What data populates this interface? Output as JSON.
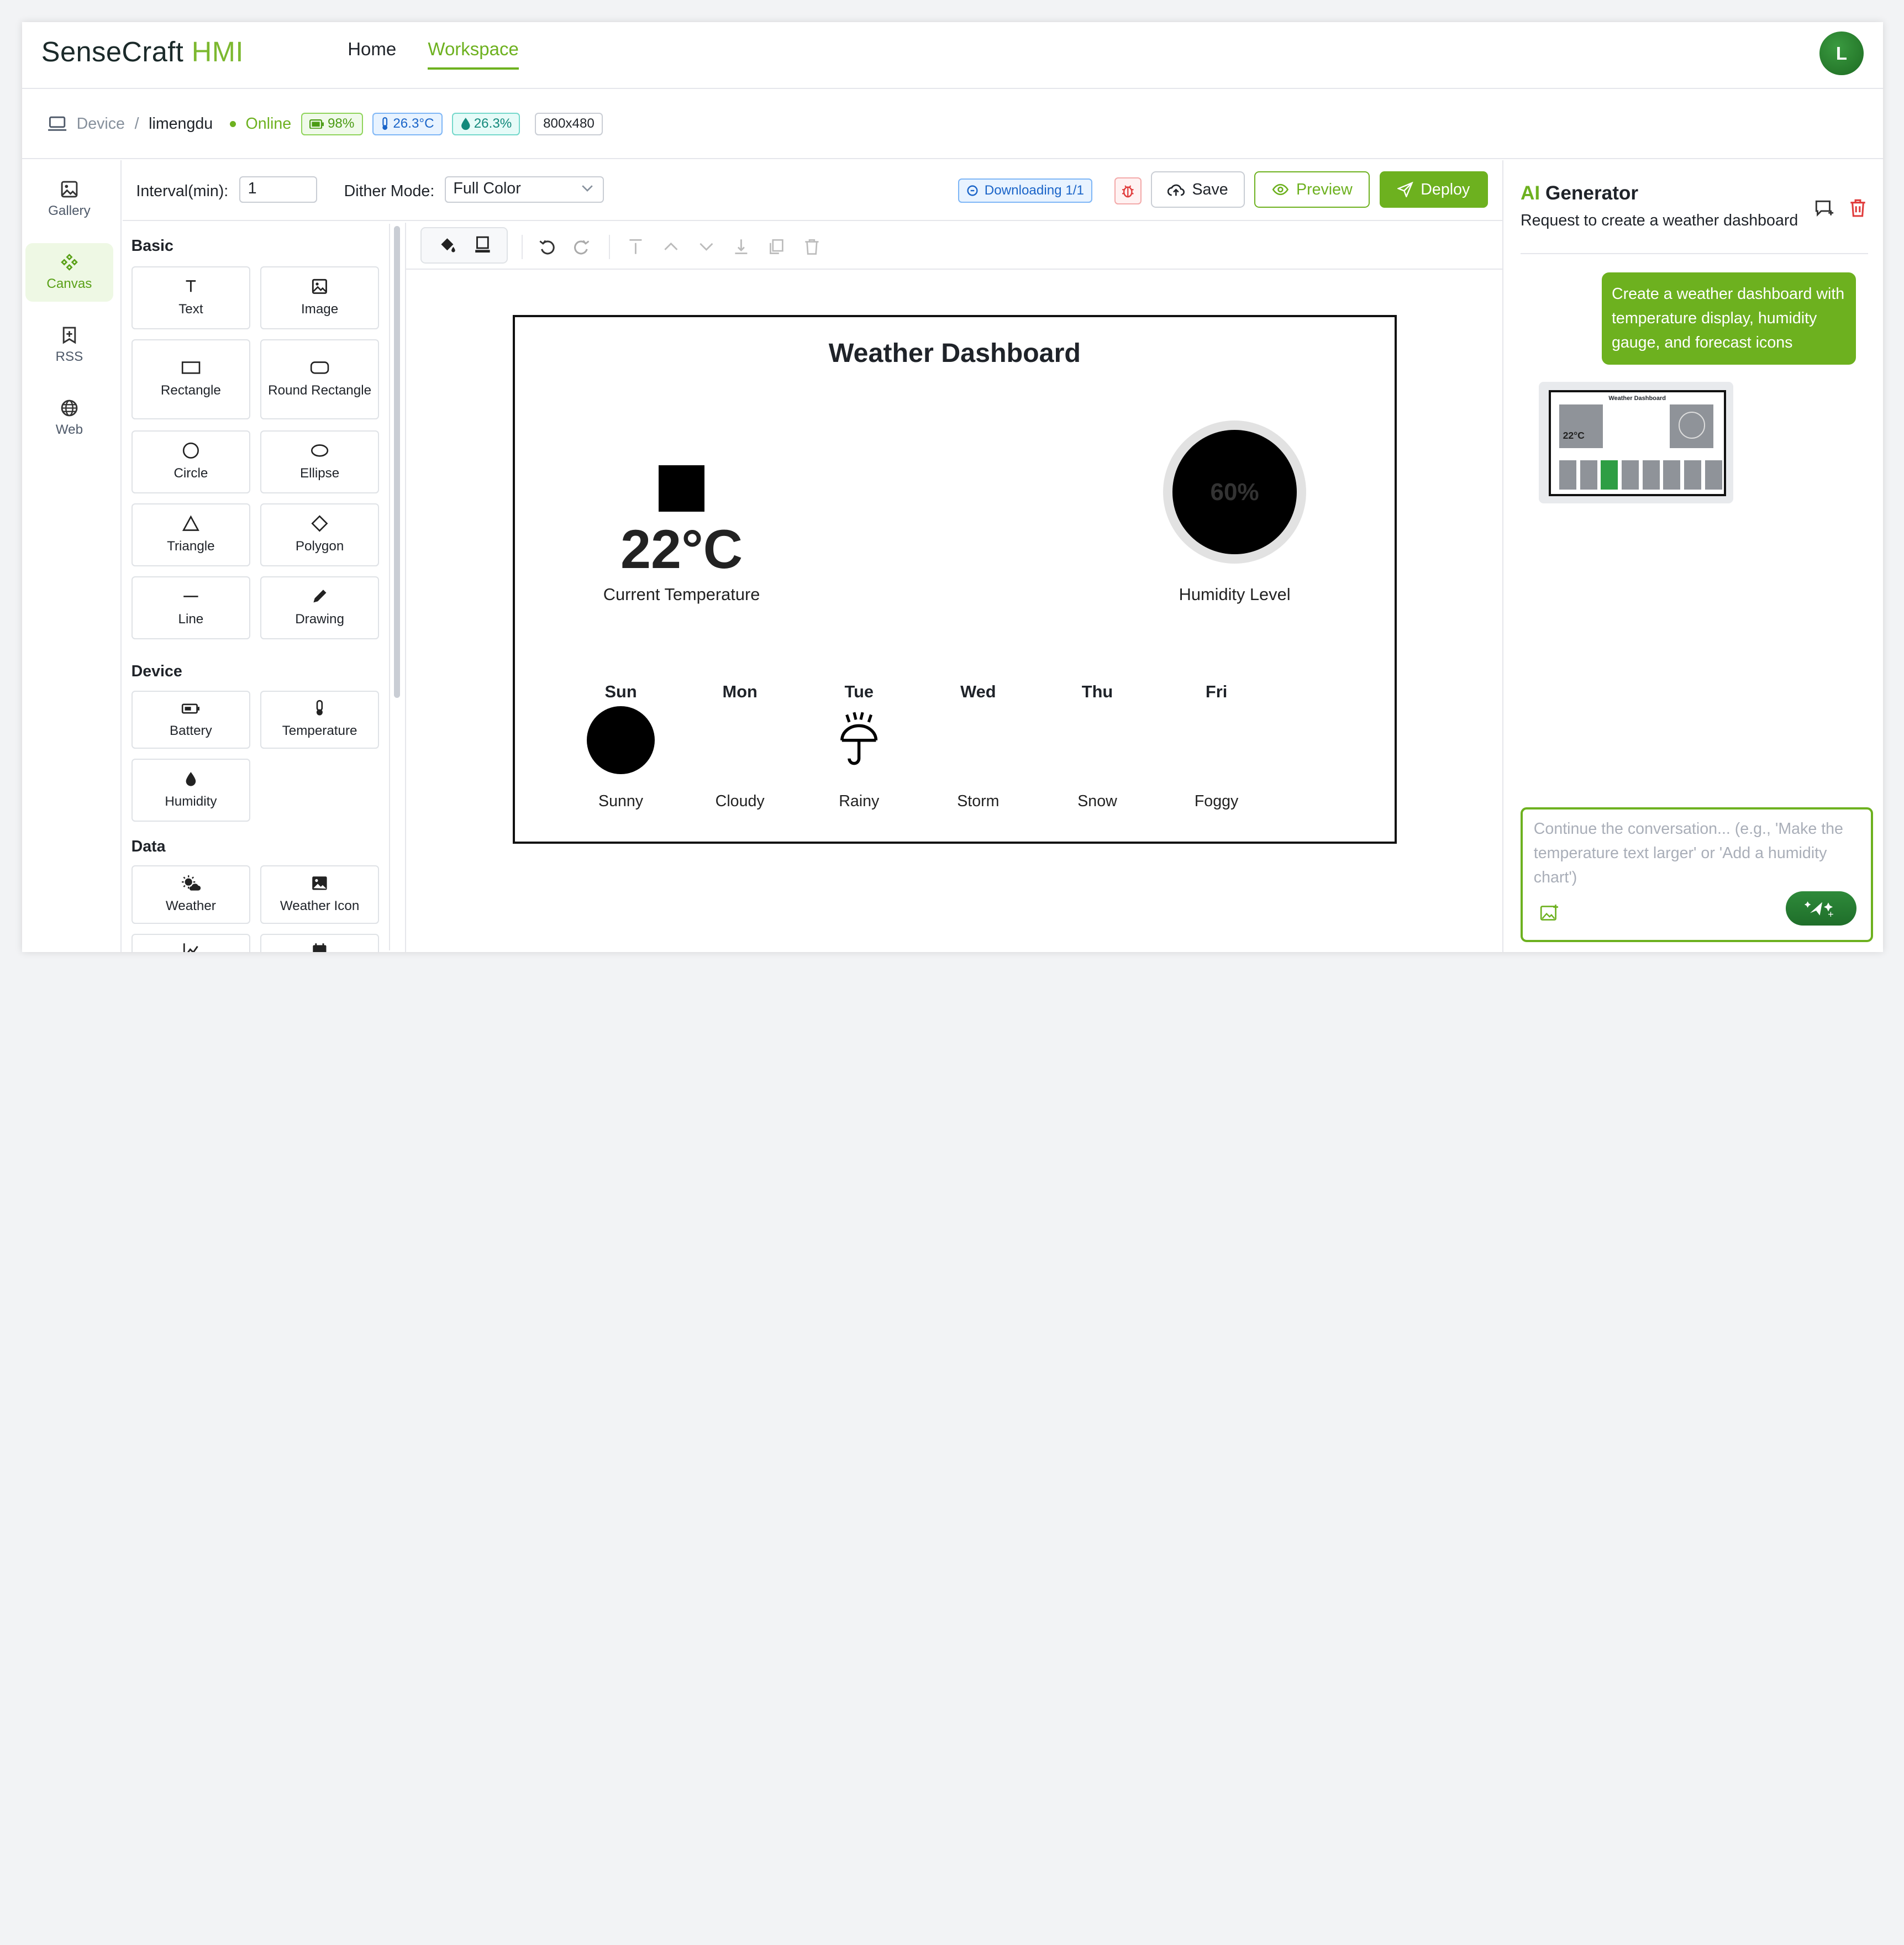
{
  "header": {
    "logo_main": "SenseCraft",
    "logo_accent": "HMI",
    "nav": [
      {
        "label": "Home",
        "active": false
      },
      {
        "label": "Workspace",
        "active": true
      }
    ],
    "avatar": "L"
  },
  "device_bar": {
    "device_label": "Device",
    "separator": "/",
    "device_name": "limengdu",
    "status": "Online",
    "battery": "98%",
    "temperature": "26.3°C",
    "humidity": "26.3%",
    "resolution": "800x480"
  },
  "sidebar": {
    "items": [
      {
        "label": "Gallery",
        "icon": "image-icon",
        "selected": false
      },
      {
        "label": "Canvas",
        "icon": "nodes-icon",
        "selected": true
      },
      {
        "label": "RSS",
        "icon": "bookmark-plus-icon",
        "selected": false
      },
      {
        "label": "Web",
        "icon": "globe-icon",
        "selected": false
      }
    ]
  },
  "toolbar": {
    "interval_label": "Interval(min):",
    "interval_value": "1",
    "dither_label": "Dither Mode:",
    "dither_value": "Full Color",
    "downloading": "Downloading 1/1",
    "save": "Save",
    "preview": "Preview",
    "deploy": "Deploy"
  },
  "components": {
    "basic_title": "Basic",
    "basic": [
      "Text",
      "Image",
      "Rectangle",
      "Round Rectangle",
      "Circle",
      "Ellipse",
      "Triangle",
      "Polygon",
      "Line",
      "Drawing"
    ],
    "device_title": "Device",
    "device": [
      "Battery",
      "Temperature",
      "Humidity"
    ],
    "data_title": "Data",
    "data": [
      "Weather",
      "Weather Icon"
    ]
  },
  "canvas": {
    "title": "Weather Dashboard",
    "temperature": "22°C",
    "temperature_label": "Current Temperature",
    "humidity": "60%",
    "humidity_label": "Humidity Level",
    "forecast": [
      {
        "day": "Sun",
        "condition": "Sunny"
      },
      {
        "day": "Mon",
        "condition": "Cloudy"
      },
      {
        "day": "Tue",
        "condition": "Rainy"
      },
      {
        "day": "Wed",
        "condition": "Storm"
      },
      {
        "day": "Thu",
        "condition": "Snow"
      },
      {
        "day": "Fri",
        "condition": "Foggy"
      }
    ]
  },
  "ai": {
    "title_accent": "AI",
    "title_rest": " Generator",
    "subtitle": "Request to create a weather dashboard",
    "user_message": "Create a weather dashboard with temperature display, humidity gauge, and forecast icons",
    "thumb_title": "Weather Dashboard",
    "thumb_temp": "22°C",
    "input_placeholder": "Continue the conversation... (e.g., 'Make the temperature text larger' or 'Add a humidity chart')"
  },
  "colors": {
    "accent": "#6db11f",
    "accent_dark": "#1f6e2a",
    "danger": "#e03b3b"
  }
}
